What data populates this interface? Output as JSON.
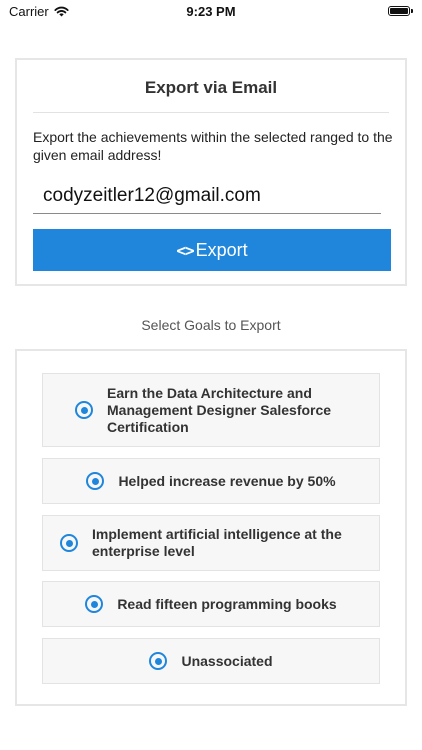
{
  "status_bar": {
    "carrier": "Carrier",
    "time": "9:23 PM"
  },
  "export_section": {
    "title": "Export via Email",
    "description": "Export the achievements within the selected ranged to the given email address!",
    "email_value": "codyzeitler12@gmail.com",
    "export_button_icon": "<>",
    "export_button_label": "Export"
  },
  "goals_section": {
    "heading": "Select Goals to Export",
    "goals": [
      {
        "label": "Earn the Data Architecture and Management Designer Salesforce Certification",
        "selected": true
      },
      {
        "label": "Helped increase revenue by 50%",
        "selected": true
      },
      {
        "label": "Implement artificial intelligence at the enterprise level",
        "selected": true
      },
      {
        "label": "Read fifteen programming books",
        "selected": true
      },
      {
        "label": "Unassociated",
        "selected": true
      }
    ]
  },
  "colors": {
    "accent": "#1f86dc"
  }
}
